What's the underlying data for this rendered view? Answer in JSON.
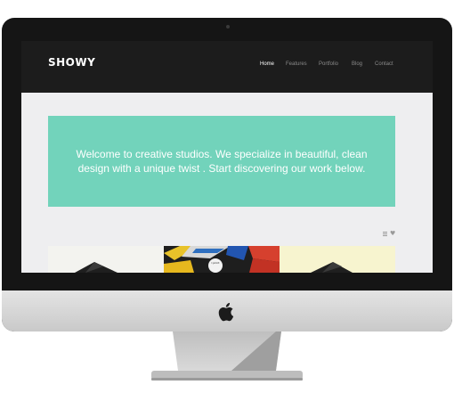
{
  "site": {
    "brand": "SHOWY",
    "nav": {
      "home": "Home",
      "features": "Features",
      "portfolio": "Portfolio",
      "blog": "Blog",
      "contact": "Contact"
    },
    "hero": {
      "text": "Welcome to creative studios. We specialize in beautiful, clean design with a unique twist . Start discovering our work below."
    },
    "thumbnail_2_sticker": "I print"
  },
  "colors": {
    "accent": "#72d3bb",
    "header_bg": "#1c1c1c",
    "page_bg": "#eeeef0"
  },
  "icons": [
    "list-icon",
    "heart-icon",
    "apple-logo-icon"
  ]
}
